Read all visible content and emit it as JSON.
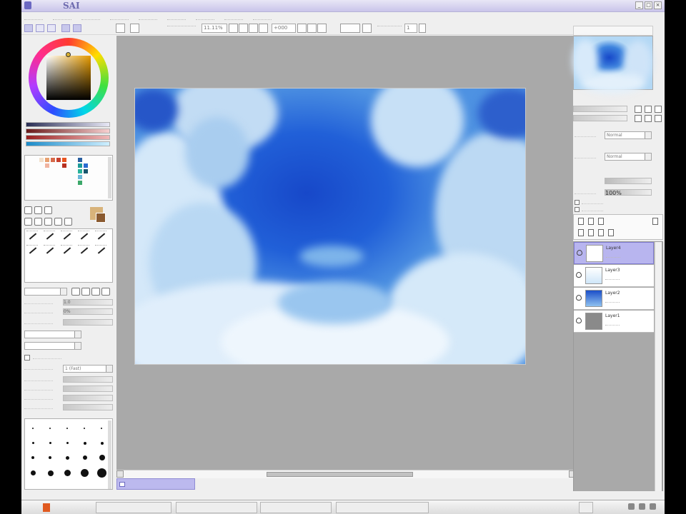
{
  "app": {
    "title": "SAI",
    "window_buttons": [
      "_",
      "□",
      "×"
    ]
  },
  "menu": {
    "items": [
      "",
      "",
      "",
      "",
      "",
      "",
      "",
      "",
      ""
    ]
  },
  "toolbar": {
    "zoom_value": "11.11%",
    "angle_value": "+000",
    "stabilizer_value": "1"
  },
  "colors": {
    "sky_deep": "#1748c9",
    "sky_mid": "#3d7edc",
    "cloud": "#e8f3fc",
    "selection_accent": "#b8b5ef",
    "brush_color": "#d8b37a"
  },
  "left_panel": {
    "brush_size": "1.0",
    "brush_min": "0%",
    "blending": "",
    "max_size": "",
    "advanced_label": "",
    "quality": "1 (Fast)"
  },
  "right_panel": {
    "navigator_zoom": "",
    "blend_mode": "Normal",
    "opacity": "100%",
    "layers": [
      {
        "name": "Layer4",
        "selected": true
      },
      {
        "name": "Layer3",
        "selected": false
      },
      {
        "name": "Layer2",
        "selected": false
      },
      {
        "name": "Layer1",
        "selected": false
      }
    ]
  },
  "canvas": {
    "doc_tab_label": ""
  },
  "status": {
    "memory": ""
  },
  "taskbar": {
    "items": [
      "",
      "",
      "",
      "",
      ""
    ],
    "clock": ""
  }
}
